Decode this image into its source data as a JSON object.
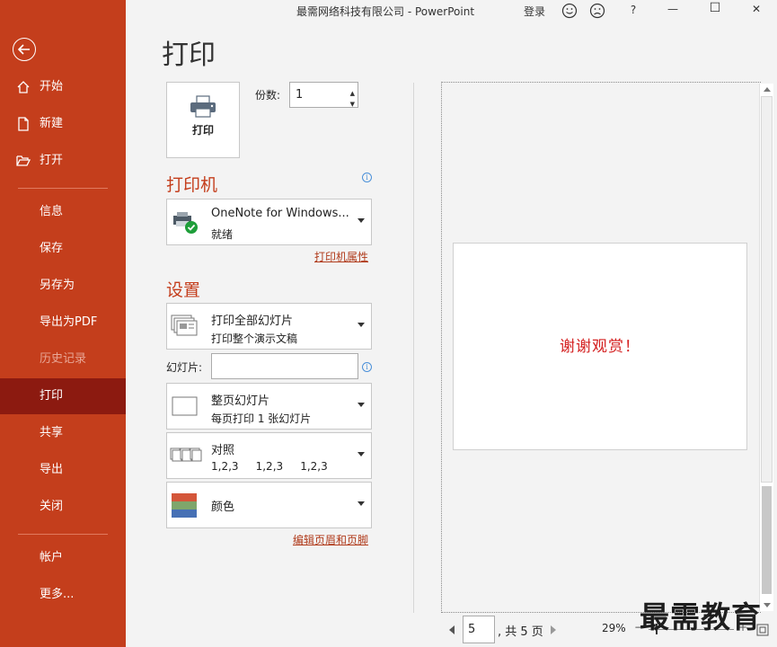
{
  "titlebar": {
    "app_title": "最需网络科技有限公司  -  PowerPoint",
    "login": "登录",
    "help": "?",
    "minimize": "—",
    "maximize": "☐",
    "close": "✕"
  },
  "sidebar": {
    "items": [
      {
        "label": "开始",
        "icon": "home-icon"
      },
      {
        "label": "新建",
        "icon": "new-file-icon"
      },
      {
        "label": "打开",
        "icon": "folder-open-icon"
      },
      {
        "label": "信息"
      },
      {
        "label": "保存"
      },
      {
        "label": "另存为"
      },
      {
        "label": "导出为PDF"
      },
      {
        "label": "历史记录",
        "disabled": true
      },
      {
        "label": "打印",
        "active": true
      },
      {
        "label": "共享"
      },
      {
        "label": "导出"
      },
      {
        "label": "关闭"
      },
      {
        "label": "帐户"
      },
      {
        "label": "更多..."
      }
    ]
  },
  "main": {
    "title": "打印",
    "print_button": "打印",
    "copies_label": "份数:",
    "copies_value": "1",
    "printer_heading": "打印机",
    "printer_name": "OneNote for Windows...",
    "printer_status": "就绪",
    "printer_properties": "打印机属性",
    "settings_heading": "设置",
    "range_title": "打印全部幻灯片",
    "range_sub": "打印整个演示文稿",
    "slides_label": "幻灯片:",
    "slides_value": "",
    "layout_title": "整页幻灯片",
    "layout_sub": "每页打印 1 张幻灯片",
    "collate_title": "对照",
    "collate_sub": "1,2,3     1,2,3     1,2,3",
    "color_title": "颜色",
    "edit_header_footer": "编辑页眉和页脚"
  },
  "preview": {
    "slide_text": "谢谢观赏！",
    "current_page": "5",
    "total_pages": ", 共 5 页",
    "zoom": "29%"
  },
  "watermark": "最需教育",
  "colors": {
    "accent": "#c43e1c",
    "active_nav": "#8c1a10",
    "slide_text": "#d42020"
  }
}
